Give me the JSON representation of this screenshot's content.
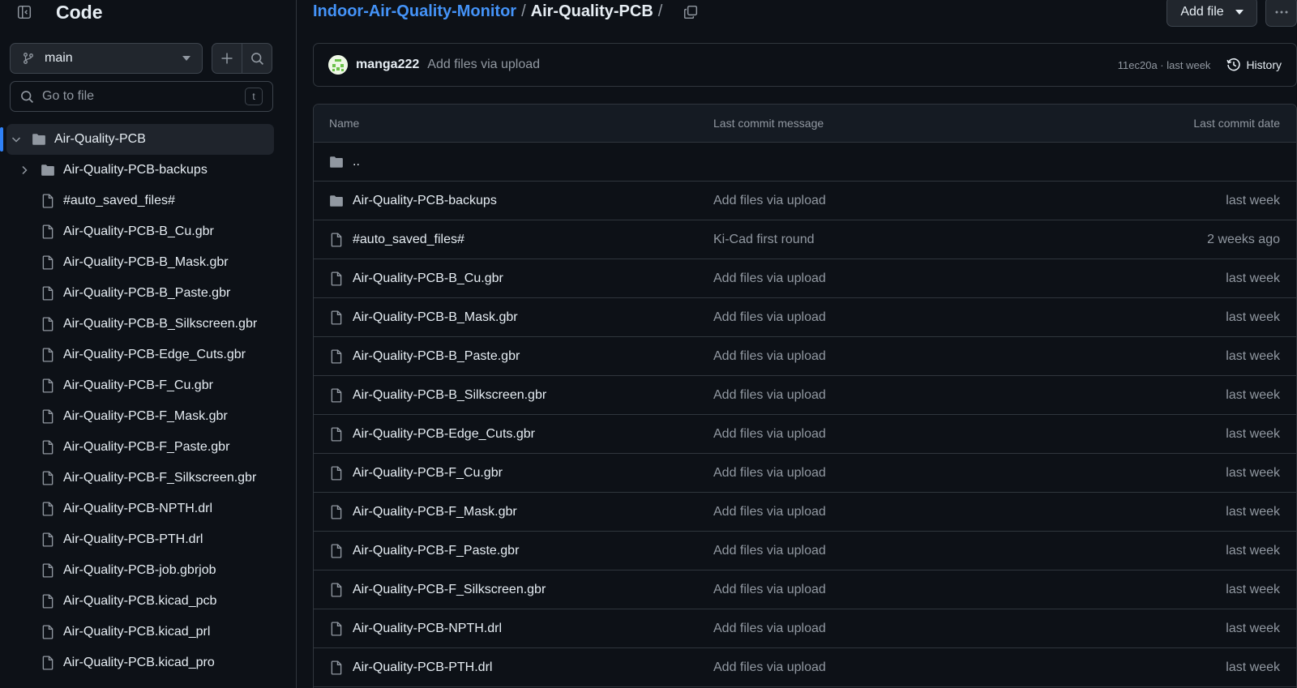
{
  "sidebar": {
    "title": "Code",
    "branch": "main",
    "search_placeholder": "Go to file",
    "search_shortcut": "t",
    "tree": [
      {
        "label": "Air-Quality-PCB",
        "type": "dir-open",
        "level": 0
      },
      {
        "label": "Air-Quality-PCB-backups",
        "type": "dir",
        "level": 1
      },
      {
        "label": "#auto_saved_files#",
        "type": "file",
        "level": 1
      },
      {
        "label": "Air-Quality-PCB-B_Cu.gbr",
        "type": "file",
        "level": 1
      },
      {
        "label": "Air-Quality-PCB-B_Mask.gbr",
        "type": "file",
        "level": 1
      },
      {
        "label": "Air-Quality-PCB-B_Paste.gbr",
        "type": "file",
        "level": 1
      },
      {
        "label": "Air-Quality-PCB-B_Silkscreen.gbr",
        "type": "file",
        "level": 1
      },
      {
        "label": "Air-Quality-PCB-Edge_Cuts.gbr",
        "type": "file",
        "level": 1
      },
      {
        "label": "Air-Quality-PCB-F_Cu.gbr",
        "type": "file",
        "level": 1
      },
      {
        "label": "Air-Quality-PCB-F_Mask.gbr",
        "type": "file",
        "level": 1
      },
      {
        "label": "Air-Quality-PCB-F_Paste.gbr",
        "type": "file",
        "level": 1
      },
      {
        "label": "Air-Quality-PCB-F_Silkscreen.gbr",
        "type": "file",
        "level": 1
      },
      {
        "label": "Air-Quality-PCB-NPTH.drl",
        "type": "file",
        "level": 1
      },
      {
        "label": "Air-Quality-PCB-PTH.drl",
        "type": "file",
        "level": 1
      },
      {
        "label": "Air-Quality-PCB-job.gbrjob",
        "type": "file",
        "level": 1
      },
      {
        "label": "Air-Quality-PCB.kicad_pcb",
        "type": "file",
        "level": 1
      },
      {
        "label": "Air-Quality-PCB.kicad_prl",
        "type": "file",
        "level": 1
      },
      {
        "label": "Air-Quality-PCB.kicad_pro",
        "type": "file",
        "level": 1
      }
    ]
  },
  "breadcrumb": {
    "repo": "Indoor-Air-Quality-Monitor",
    "separator": "/",
    "current": "Air-Quality-PCB"
  },
  "actions": {
    "add_file": "Add file"
  },
  "latest_commit": {
    "author": "manga222",
    "message": "Add files via upload",
    "meta": "11ec20a · last week",
    "history": "History"
  },
  "table": {
    "headers": {
      "name": "Name",
      "message": "Last commit message",
      "date": "Last commit date"
    },
    "parent_label": "..",
    "rows": [
      {
        "name": "Air-Quality-PCB-backups",
        "type": "dir",
        "message": "Add files via upload",
        "date": "last week"
      },
      {
        "name": "#auto_saved_files#",
        "type": "file",
        "message": "Ki-Cad first round",
        "date": "2 weeks ago"
      },
      {
        "name": "Air-Quality-PCB-B_Cu.gbr",
        "type": "file",
        "message": "Add files via upload",
        "date": "last week"
      },
      {
        "name": "Air-Quality-PCB-B_Mask.gbr",
        "type": "file",
        "message": "Add files via upload",
        "date": "last week"
      },
      {
        "name": "Air-Quality-PCB-B_Paste.gbr",
        "type": "file",
        "message": "Add files via upload",
        "date": "last week"
      },
      {
        "name": "Air-Quality-PCB-B_Silkscreen.gbr",
        "type": "file",
        "message": "Add files via upload",
        "date": "last week"
      },
      {
        "name": "Air-Quality-PCB-Edge_Cuts.gbr",
        "type": "file",
        "message": "Add files via upload",
        "date": "last week"
      },
      {
        "name": "Air-Quality-PCB-F_Cu.gbr",
        "type": "file",
        "message": "Add files via upload",
        "date": "last week"
      },
      {
        "name": "Air-Quality-PCB-F_Mask.gbr",
        "type": "file",
        "message": "Add files via upload",
        "date": "last week"
      },
      {
        "name": "Air-Quality-PCB-F_Paste.gbr",
        "type": "file",
        "message": "Add files via upload",
        "date": "last week"
      },
      {
        "name": "Air-Quality-PCB-F_Silkscreen.gbr",
        "type": "file",
        "message": "Add files via upload",
        "date": "last week"
      },
      {
        "name": "Air-Quality-PCB-NPTH.drl",
        "type": "file",
        "message": "Add files via upload",
        "date": "last week"
      },
      {
        "name": "Air-Quality-PCB-PTH.drl",
        "type": "file",
        "message": "Add files via upload",
        "date": "last week"
      }
    ]
  },
  "colors": {
    "background": "#0d1117",
    "border": "#30363d",
    "link": "#4493f8",
    "muted": "#9198a1",
    "active_indicator": "#2f81f7"
  }
}
